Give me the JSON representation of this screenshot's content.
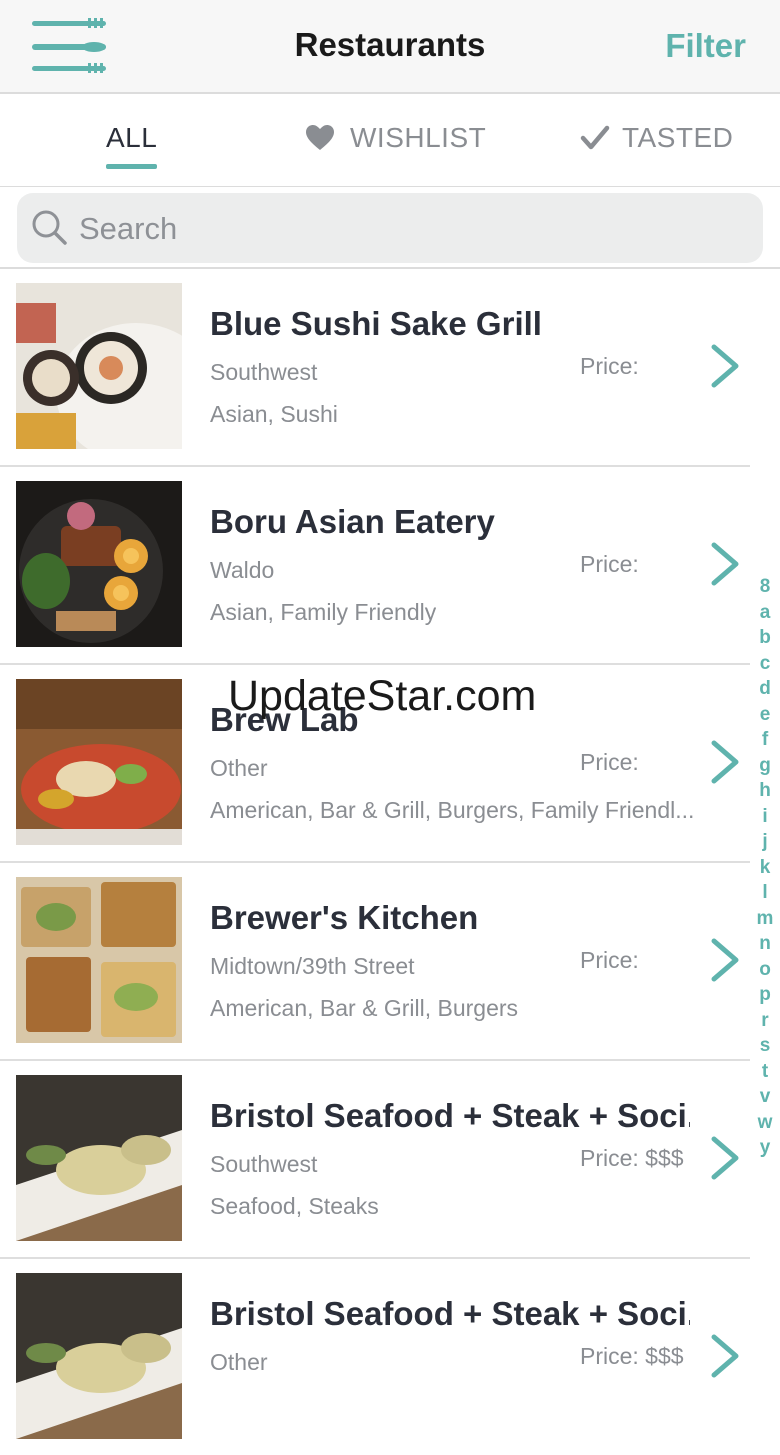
{
  "colors": {
    "accent": "#5fb3ad",
    "text": "#2b2f3a",
    "muted": "#8a8d92",
    "background": "#ffffff",
    "nav_bg": "#f7f7f7"
  },
  "nav": {
    "title": "Restaurants",
    "filter_label": "Filter",
    "menu_icon": "utensils-menu-icon"
  },
  "tabs": [
    {
      "label": "ALL",
      "icon": "",
      "active": true
    },
    {
      "label": "WISHLIST",
      "icon": "heart-icon",
      "active": false
    },
    {
      "label": "TASTED",
      "icon": "checkmark-icon",
      "active": false
    }
  ],
  "search": {
    "placeholder": "Search",
    "value": ""
  },
  "restaurants": [
    {
      "name": "Blue Sushi Sake Grill",
      "area": "Southwest",
      "cuisine": "Asian, Sushi",
      "price": "Price:"
    },
    {
      "name": "Boru Asian Eatery",
      "area": "Waldo",
      "cuisine": "Asian, Family Friendly",
      "price": "Price:"
    },
    {
      "name": "Brew Lab",
      "area": "Other",
      "cuisine": "American, Bar & Grill, Burgers, Family Friendl...",
      "price": "Price:"
    },
    {
      "name": "Brewer's Kitchen",
      "area": "Midtown/39th Street",
      "cuisine": "American, Bar & Grill, Burgers",
      "price": "Price:"
    },
    {
      "name": "Bristol Seafood + Steak + Soci...",
      "area": "Southwest",
      "cuisine": "Seafood, Steaks",
      "price": "Price: $$$"
    },
    {
      "name": "Bristol Seafood + Steak + Soci...",
      "area": "Other",
      "cuisine": "",
      "price": "Price: $$$"
    }
  ],
  "index_letters": [
    "8",
    "a",
    "b",
    "c",
    "d",
    "e",
    "f",
    "g",
    "h",
    "i",
    "j",
    "k",
    "l",
    "m",
    "n",
    "o",
    "p",
    "r",
    "s",
    "t",
    "v",
    "w",
    "y"
  ],
  "watermark": "UpdateStar.com"
}
